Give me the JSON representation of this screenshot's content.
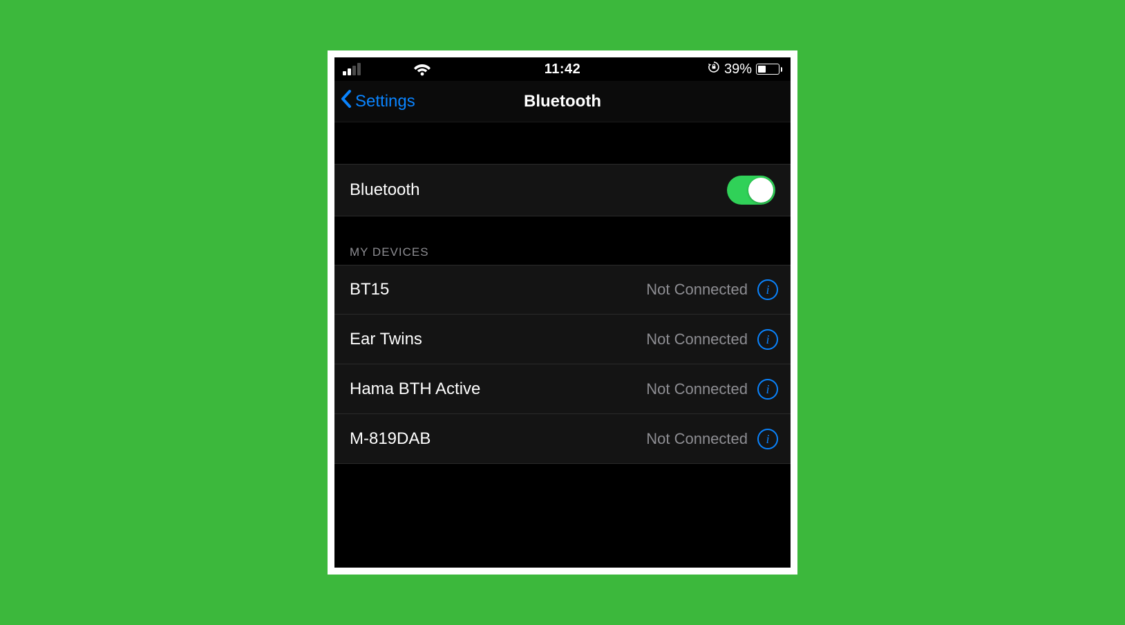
{
  "status_bar": {
    "time": "11:42",
    "battery_percent_label": "39%",
    "battery_level": 39
  },
  "nav": {
    "back_label": "Settings",
    "title": "Bluetooth"
  },
  "bluetooth": {
    "row_label": "Bluetooth",
    "enabled": true
  },
  "devices": {
    "section_title": "MY DEVICES",
    "items": [
      {
        "name": "BT15",
        "status": "Not Connected"
      },
      {
        "name": "Ear Twins",
        "status": "Not Connected"
      },
      {
        "name": "Hama BTH Active",
        "status": "Not Connected"
      },
      {
        "name": "M-819DAB",
        "status": "Not Connected"
      }
    ]
  },
  "colors": {
    "background": "#3cb83c",
    "ios_blue": "#0a84ff",
    "toggle_green": "#30d158",
    "secondary_text": "#8e8e93"
  }
}
